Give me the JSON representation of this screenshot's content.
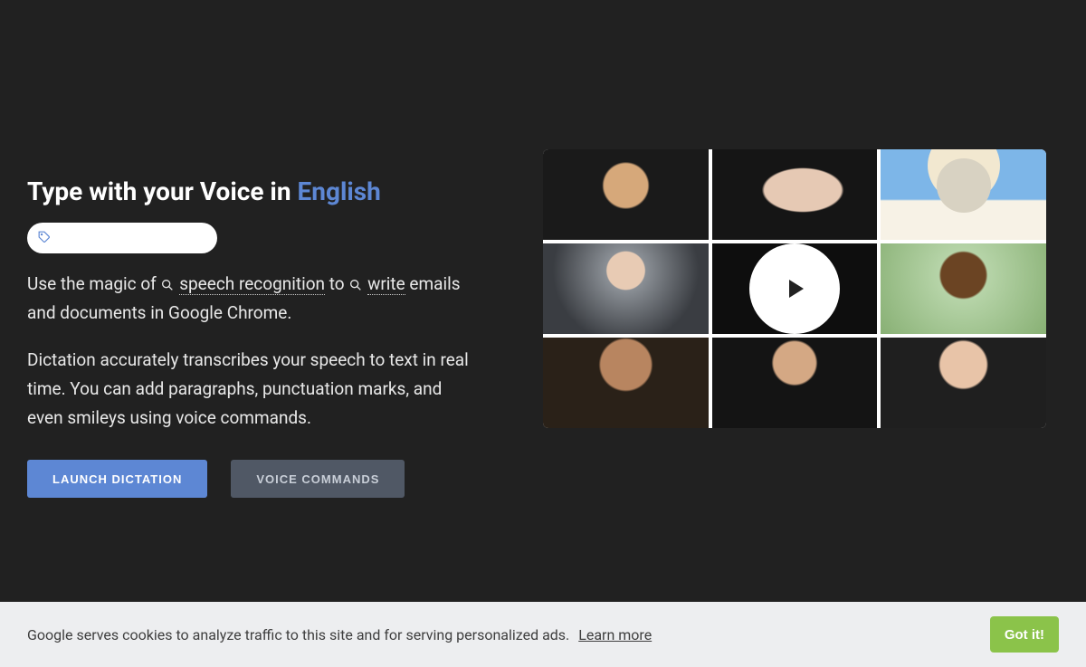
{
  "hero": {
    "headline_prefix": "Type with your Voice in ",
    "headline_language": "English",
    "body": {
      "part1": "Use the magic of ",
      "link1": "speech recognition",
      "part2": " to ",
      "link2": "write",
      "part3": " emails and documents in Google Chrome.",
      "paragraph2": "Dictation accurately transcribes your speech to text in real time. You can add paragraphs, punctuation marks, and even smileys using voice commands."
    },
    "buttons": {
      "primary": "LAUNCH DICTATION",
      "secondary": "VOICE COMMANDS"
    }
  },
  "cookie": {
    "message": "Google serves cookies to analyze traffic to this site and for serving personalized ads.",
    "learn_more": "Learn more",
    "accept": "Got it!"
  }
}
